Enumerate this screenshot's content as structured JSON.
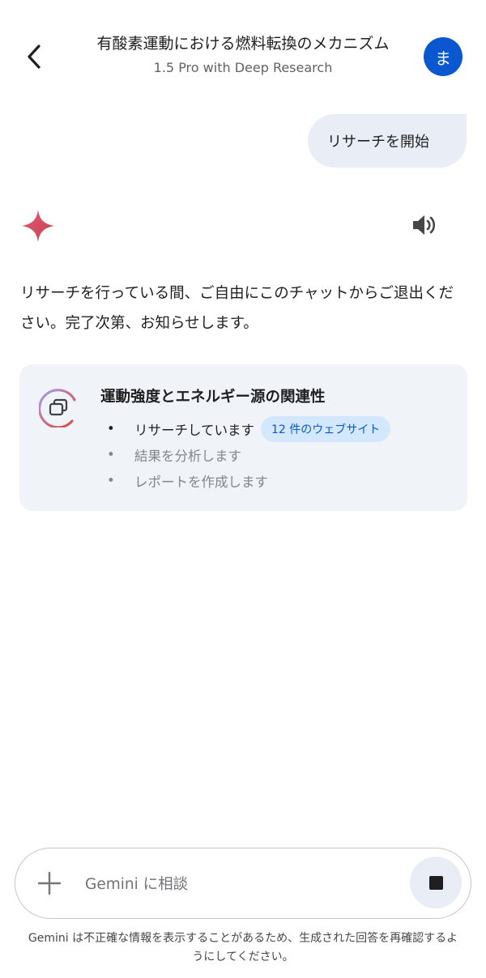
{
  "header": {
    "title": "有酸素運動における燃料転換のメカニズム",
    "subtitle": "1.5 Pro with Deep Research",
    "avatar_initial": "ま",
    "back_icon": "arrow-back-icon"
  },
  "conversation": {
    "user_message": "リサーチを開始",
    "assistant_icon": "gemini-sparkle-icon",
    "speaker_icon": "volume-icon",
    "assistant_message": "リサーチを行っている間、ご自由にこのチャットからご退出ください。完了次第、お知らせします。"
  },
  "research_card": {
    "icon": "deep-research-icon",
    "title": "運動強度とエネルギー源の関連性",
    "steps": [
      {
        "bullet": "•",
        "label": "リサーチしています",
        "chip": "12 件のウェブサイト",
        "state": "active"
      },
      {
        "bullet": "•",
        "label": "結果を分析します",
        "state": "pending"
      },
      {
        "bullet": "•",
        "label": "レポートを作成します",
        "state": "pending"
      }
    ]
  },
  "input_bar": {
    "placeholder": "Gemini に相談",
    "value": "",
    "plus_icon": "plus-icon",
    "stop_icon": "stop-icon"
  },
  "disclaimer": "Gemini は不正確な情報を表示することがあるため、生成された回答を再確認するようにしてください。",
  "colors": {
    "accent": "#0b57d0",
    "bubble": "#e9eef6",
    "card": "#f0f4f9",
    "chip": "#d3e8fd"
  }
}
